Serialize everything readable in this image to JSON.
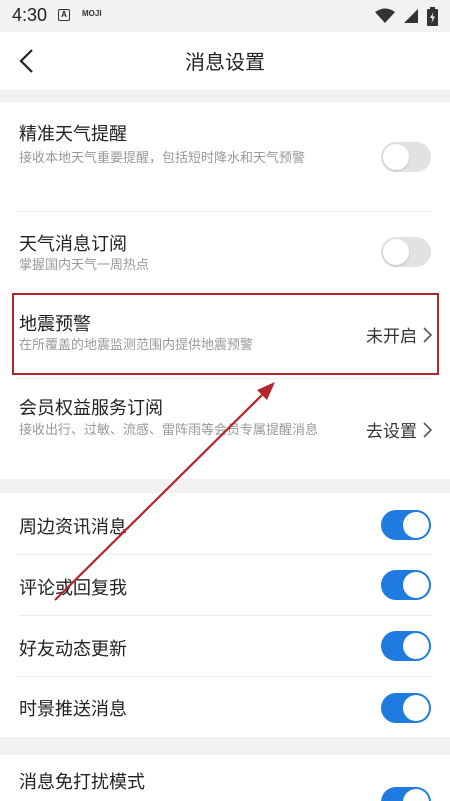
{
  "status_bar": {
    "time": "4:30",
    "app_icon_letter": "A",
    "app_label": "MOJI"
  },
  "header": {
    "title": "消息设置"
  },
  "settings": {
    "precise_weather": {
      "title": "精准天气提醒",
      "subtitle": "接收本地天气重要提醒，包括短时降水和天气预警",
      "enabled": false
    },
    "weather_subscription": {
      "title": "天气消息订阅",
      "subtitle": "掌握国内天气一周热点",
      "enabled": false
    },
    "earthquake": {
      "title": "地震预警",
      "subtitle": "在所覆盖的地震监测范围内提供地震预警",
      "value": "未开启"
    },
    "member_service": {
      "title": "会员权益服务订阅",
      "subtitle": "接收出行、过敏、流感、雷阵雨等会员专属提醒消息",
      "value": "去设置"
    },
    "nearby_news": {
      "title": "周边资讯消息",
      "enabled": true
    },
    "comment_reply": {
      "title": "评论或回复我",
      "enabled": true
    },
    "friend_updates": {
      "title": "好友动态更新",
      "enabled": true
    },
    "live_push": {
      "title": "时景推送消息",
      "enabled": true
    },
    "dnd_mode": {
      "title": "消息免打扰模式",
      "enabled": true
    }
  },
  "colors": {
    "toggle_on": "#1f7be0",
    "toggle_off": "#e2e2e2",
    "annotation": "#b3262b"
  }
}
